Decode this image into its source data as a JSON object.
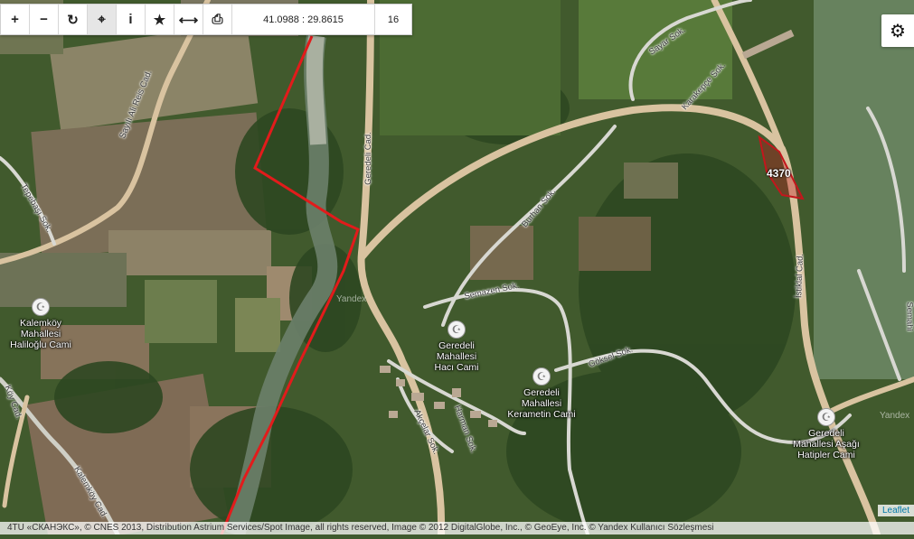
{
  "toolbar": {
    "coordinates": "41.0988 : 29.8615",
    "zoom_level": "16",
    "tools": [
      {
        "name": "zoom-in",
        "glyph": "+"
      },
      {
        "name": "zoom-out",
        "glyph": "−"
      },
      {
        "name": "refresh",
        "glyph": "↻"
      },
      {
        "name": "locate",
        "glyph": "⌖"
      },
      {
        "name": "info",
        "glyph": "i"
      },
      {
        "name": "favorite",
        "glyph": "★"
      },
      {
        "name": "measure",
        "glyph": "⟷"
      },
      {
        "name": "print",
        "glyph": "⎙"
      }
    ]
  },
  "settings": {
    "icon": "gear-icon",
    "glyph": "⚙"
  },
  "parcel": {
    "label": "4370",
    "color": "#c4161c"
  },
  "boundary_color": "#e21b1b",
  "pois": [
    {
      "label_lines": [
        "Kalemköy",
        "Mahallesi",
        "Haliloğlu Cami"
      ]
    },
    {
      "label_lines": [
        "Geredeli",
        "Mahallesi",
        "Hacı Cami"
      ]
    },
    {
      "label_lines": [
        "Geredeli",
        "Mahallesi",
        "Kerametin Cami"
      ]
    },
    {
      "label_lines": [
        "Geredeli",
        "Mahallesi Aşağı",
        "Hatipler Cami"
      ]
    }
  ],
  "streets": [
    {
      "label": "Sayılı Ali Reis Cad."
    },
    {
      "label": "Geredeli Cad."
    },
    {
      "label": "Tepebaşı Sok."
    },
    {
      "label": "Burhan Sok."
    },
    {
      "label": "Semazen Sok."
    },
    {
      "label": "Göksel Sok."
    },
    {
      "label": "İstiklal Cad."
    },
    {
      "label": "Sayar Sok."
    },
    {
      "label": "Karakepçe Sok."
    },
    {
      "label": "Kalemköy Cad."
    },
    {
      "label": "Akçelar Sok."
    },
    {
      "label": "Harman Sok."
    },
    {
      "label": "Köy Cad."
    },
    {
      "label": "Yandex"
    },
    {
      "label": "Yandex"
    },
    {
      "label": "Semahi"
    }
  ],
  "leaflet_link": "Leaflet",
  "attribution": "4TU «СКАНЭКС», © CNES 2013, Distribution Astrium Services/Spot Image, all rights reserved, Image © 2012 DigitalGlobe, Inc., © GeoEye, Inc. © Yandex Kullanıcı Sözleşmesi"
}
